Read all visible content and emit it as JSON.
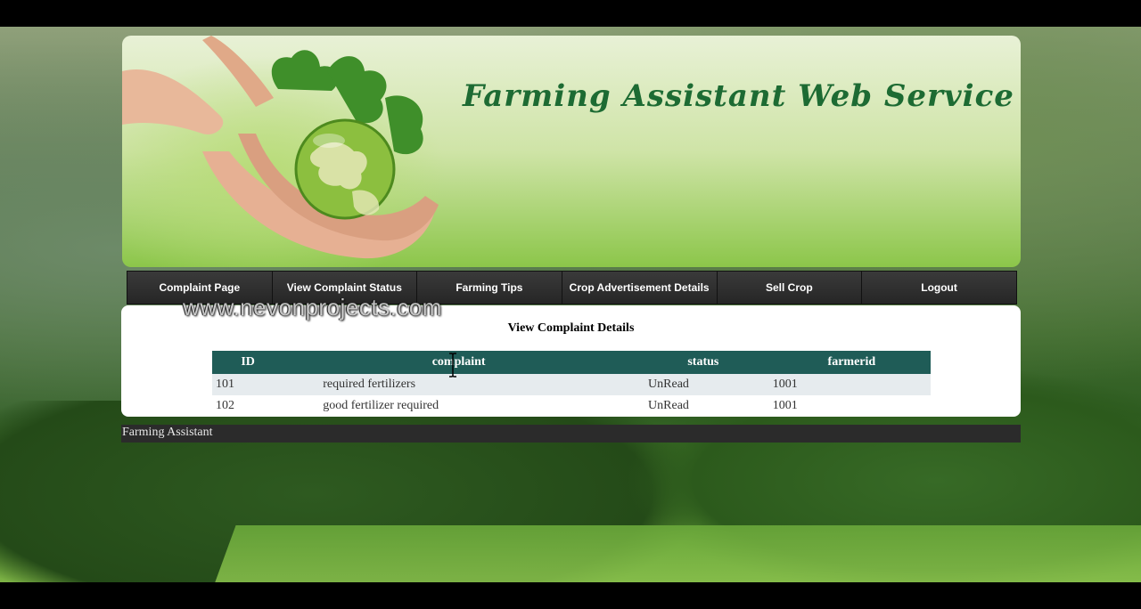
{
  "header": {
    "title": "Farming Assistant Web Service"
  },
  "watermark": "www.nevonprojects.com",
  "nav": {
    "items": [
      "Complaint Page",
      "View Complaint Status",
      "Farming Tips",
      "Crop Advertisement Details",
      "Sell Crop",
      "Logout"
    ]
  },
  "main": {
    "title": "View Complaint Details",
    "table": {
      "columns": [
        "ID",
        "complaint",
        "status",
        "farmerid"
      ],
      "rows": [
        [
          "101",
          "required fertilizers",
          "UnRead",
          "1001"
        ],
        [
          "102",
          "good fertilizer required",
          "UnRead",
          "1001"
        ]
      ]
    }
  },
  "footer": {
    "text": "Farming Assistant"
  },
  "colors": {
    "title_green": "#1d6b33",
    "nav_bg": "#2c2c2c",
    "table_header": "#1f5c57",
    "row_alt": "#e6ebee"
  }
}
